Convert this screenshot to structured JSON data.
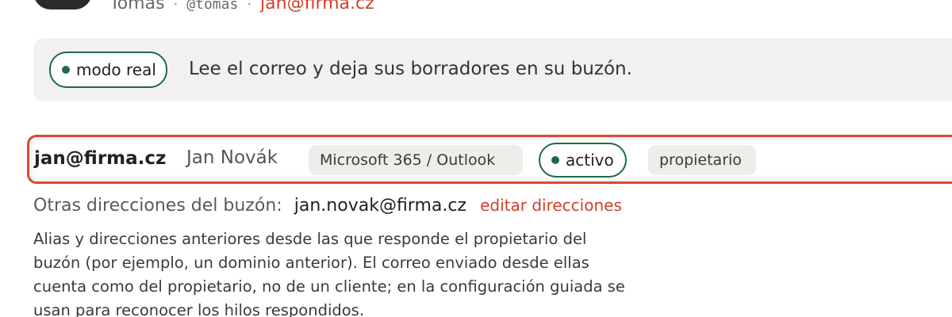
{
  "user": {
    "name": "Tomas",
    "handle": "@tomas",
    "email": "jan@firma.cz",
    "separator": "·"
  },
  "mode": {
    "badge": "modo real",
    "description": "Lee el correo y deja sus borradores en su buzón."
  },
  "account": {
    "email": "jan@firma.cz",
    "name": "Jan Novák",
    "provider": "Microsoft 365 / Outlook",
    "status": "activo",
    "role": "propietario"
  },
  "other_addresses": {
    "label": "Otras direcciones del buzón:",
    "value": "jan.novak@firma.cz",
    "edit_link": "editar direcciones",
    "help": "Alias y direcciones anteriores desde las que responde el propietario del buzón (por ejemplo, un dominio anterior). El correo enviado desde ellas cuenta como del propietario, no de un cliente; en la configuración guiada se usan para reconocer los hilos respondidos."
  },
  "colors": {
    "accent": "#d0402a",
    "active_green": "#1d6b46",
    "highlight_border": "#d94a2e",
    "banner_bg": "#f2f1ef"
  }
}
